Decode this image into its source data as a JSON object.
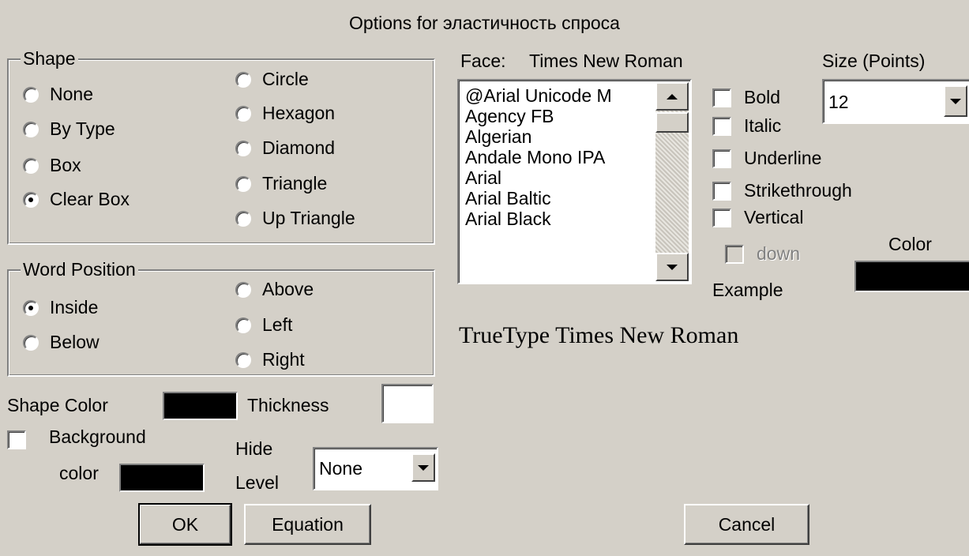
{
  "dialog": {
    "title": "Options for эластичность спроса"
  },
  "shape": {
    "legend": "Shape",
    "options_left": [
      "None",
      "By Type",
      "Box",
      "Clear Box"
    ],
    "options_right": [
      "Circle",
      "Hexagon",
      "Diamond",
      "Triangle",
      "Up Triangle"
    ],
    "selected": "Clear Box"
  },
  "word_position": {
    "legend": "Word Position",
    "options_left": [
      "Inside",
      "Below"
    ],
    "options_right": [
      "Above",
      "Left",
      "Right"
    ],
    "selected": "Inside"
  },
  "shape_color": {
    "label": "Shape Color",
    "color": "#000000"
  },
  "thickness": {
    "label": "Thickness",
    "value": ""
  },
  "background": {
    "label_line1": "Background",
    "label_line2": "color",
    "checked": false,
    "color": "#000000"
  },
  "hide_level": {
    "label_line1": "Hide",
    "label_line2": "Level",
    "value": "None"
  },
  "face": {
    "label": "Face:",
    "value": "Times New Roman",
    "fonts": [
      "@Arial Unicode M",
      "Agency FB",
      "Algerian",
      "Andale Mono IPA",
      "Arial",
      "Arial Baltic",
      "Arial Black"
    ]
  },
  "size": {
    "label": "Size (Points)",
    "value": "12"
  },
  "styles": {
    "bold": "Bold",
    "italic": "Italic",
    "underline": "Underline",
    "strikethrough": "Strikethrough",
    "vertical": "Vertical",
    "down": "down"
  },
  "color": {
    "label": "Color",
    "value": "#000000"
  },
  "example": {
    "label": "Example",
    "text": "TrueType Times New Roman"
  },
  "buttons": {
    "ok": "OK",
    "equation": "Equation",
    "cancel": "Cancel"
  }
}
